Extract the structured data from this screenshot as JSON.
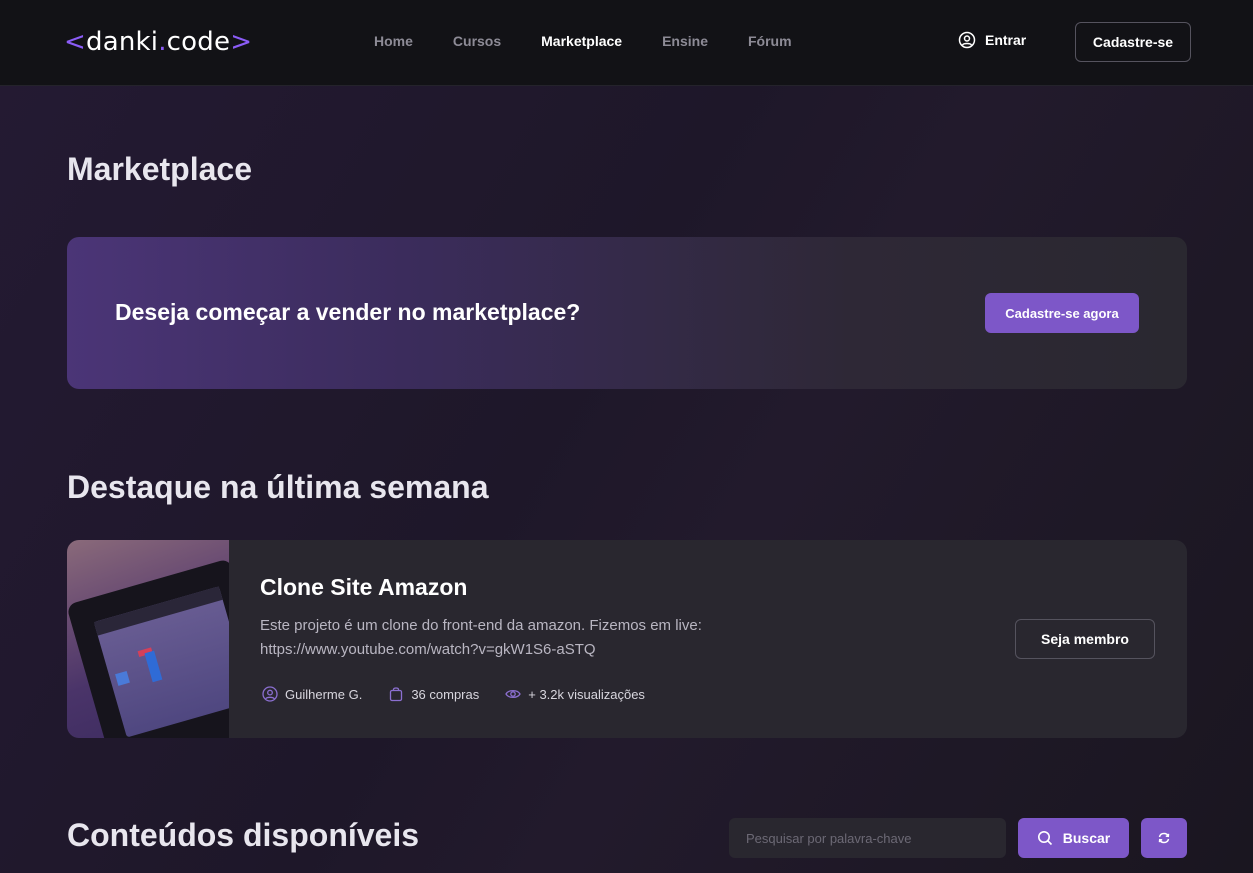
{
  "header": {
    "logo": {
      "open": "<",
      "left": "danki",
      "dot": ".",
      "right": "code",
      "close": ">"
    },
    "nav": [
      {
        "label": "Home",
        "active": false
      },
      {
        "label": "Cursos",
        "active": false
      },
      {
        "label": "Marketplace",
        "active": true
      },
      {
        "label": "Ensine",
        "active": false
      },
      {
        "label": "Fórum",
        "active": false
      }
    ],
    "login_label": "Entrar",
    "signup_label": "Cadastre-se"
  },
  "page_title": "Marketplace",
  "banner": {
    "text": "Deseja começar a vender no marketplace?",
    "button_label": "Cadastre-se agora"
  },
  "featured": {
    "section_title": "Destaque na última semana",
    "title": "Clone Site Amazon",
    "description": "Este projeto é um clone do front-end da amazon. Fizemos em live: https://www.youtube.com/watch?v=gkW1S6-aSTQ",
    "author": "Guilherme G.",
    "purchases": "36 compras",
    "views": "+ 3.2k visualizações",
    "button_label": "Seja membro"
  },
  "contents": {
    "section_title": "Conteúdos disponíveis",
    "search_placeholder": "Pesquisar por palavra-chave",
    "search_button_label": "Buscar"
  },
  "colors": {
    "accent": "#7d57c8",
    "background": "#1e1729",
    "header_bg": "#121216",
    "card_bg": "#29272f"
  }
}
